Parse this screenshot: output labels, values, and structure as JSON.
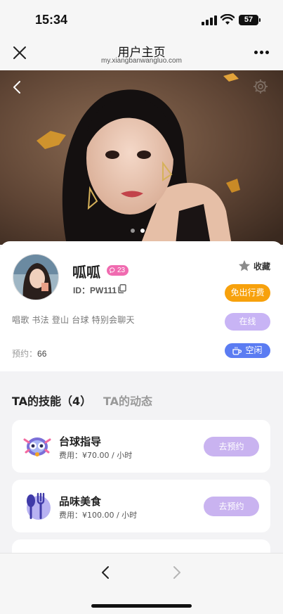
{
  "status_bar": {
    "time": "15:34",
    "battery": "57"
  },
  "header": {
    "title": "用户主页",
    "url": "my.xiangbanwangluo.com"
  },
  "profile": {
    "name": "呱呱",
    "badge_count": "23",
    "id_text": "ID：PW111",
    "favorite_label": "收藏",
    "free_travel_label": "免出行费",
    "tags": "唱歌 书法 登山 台球 特别会聊天",
    "online_label": "在线",
    "bookings_label": "预约：",
    "bookings_count": "66",
    "idle_label": "空闲"
  },
  "tabs": {
    "skills": "TA的技能（4）",
    "feed": "TA的动态"
  },
  "skills": [
    {
      "title": "台球指导",
      "price": "费用：¥70.00 / 小时",
      "book_label": "去预约",
      "icon": "billiards-icon"
    },
    {
      "title": "品味美食",
      "price": "费用：¥100.00 / 小时",
      "book_label": "去预约",
      "icon": "food-icon"
    }
  ],
  "colors": {
    "accent_orange": "#f7a10c",
    "accent_purple": "#c8b4f5",
    "accent_blue": "#5b7cf2",
    "badge_pink": "#f06bb0"
  },
  "icons": [
    "close-icon",
    "more-icon",
    "back-icon",
    "settings-icon",
    "star-icon",
    "copy-icon",
    "chat-icon",
    "cup-icon",
    "forward-icon"
  ]
}
